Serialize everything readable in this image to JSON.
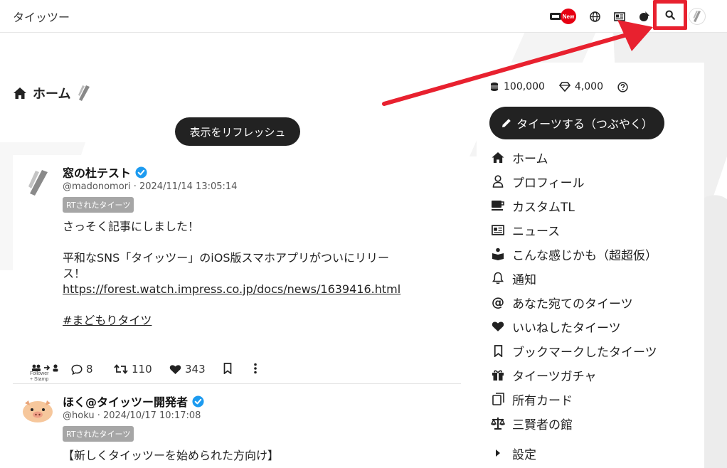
{
  "header": {
    "site_title": "タイッツー",
    "new_badge": "New",
    "icons": [
      "ticket-icon",
      "globe-icon",
      "news-icon",
      "gacha-icon",
      "search-icon",
      "user-avatar"
    ]
  },
  "main": {
    "heading": "ホーム",
    "refresh_label": "表示をリフレッシュ"
  },
  "posts": [
    {
      "display_name": "窓の杜テスト",
      "meta": "@madonomori · 2024/11/14 13:05:14",
      "badge": "RTされたタイーツ",
      "lines": [
        "さっそく記事にしました！",
        "",
        "平和なSNS「タイッツー」のiOS版スマホアプリがついにリリース！",
        "https://forest.watch.impress.co.jp/docs/news/1639416.html",
        "",
        "#まどもりタイツ"
      ],
      "follower_stamp": "Follower\n+ Stamp",
      "replies": "8",
      "retweets": "110",
      "likes": "343"
    },
    {
      "display_name": "ほく@タイッツー開発者",
      "meta": "@hoku · 2024/10/17 10:17:08",
      "badge": "RTされたタイーツ",
      "lines": [
        "【新しくタイッツーを始められた方向け】"
      ]
    }
  ],
  "sidebar": {
    "coins": "100,000",
    "gems": "4,000",
    "tweet_button": "タイーツする（つぶやく）",
    "nav": [
      {
        "label": "ホーム",
        "icon": "home-icon"
      },
      {
        "label": "プロフィール",
        "icon": "user-icon"
      },
      {
        "label": "カスタムTL",
        "icon": "coffee-icon"
      },
      {
        "label": "ニュース",
        "icon": "news-icon"
      },
      {
        "label": "こんな感じかも（超超仮）",
        "icon": "book-reader-icon"
      },
      {
        "label": "通知",
        "icon": "bell-icon"
      },
      {
        "label": "あなた宛てのタイーツ",
        "icon": "at-icon"
      },
      {
        "label": "いいねしたタイーツ",
        "icon": "heart-icon"
      },
      {
        "label": "ブックマークしたタイーツ",
        "icon": "bookmark-icon"
      },
      {
        "label": "タイーツガチャ",
        "icon": "gift-icon"
      },
      {
        "label": "所有カード",
        "icon": "cards-icon"
      },
      {
        "label": "三賢者の館",
        "icon": "scale-icon"
      },
      {
        "label": "設定",
        "icon": "caret-right-icon"
      }
    ]
  },
  "colors": {
    "accent_red": "#e8212f",
    "verified_blue": "#1d9bf0",
    "button_dark": "#222222",
    "badge_gray": "#a6a6a6"
  }
}
